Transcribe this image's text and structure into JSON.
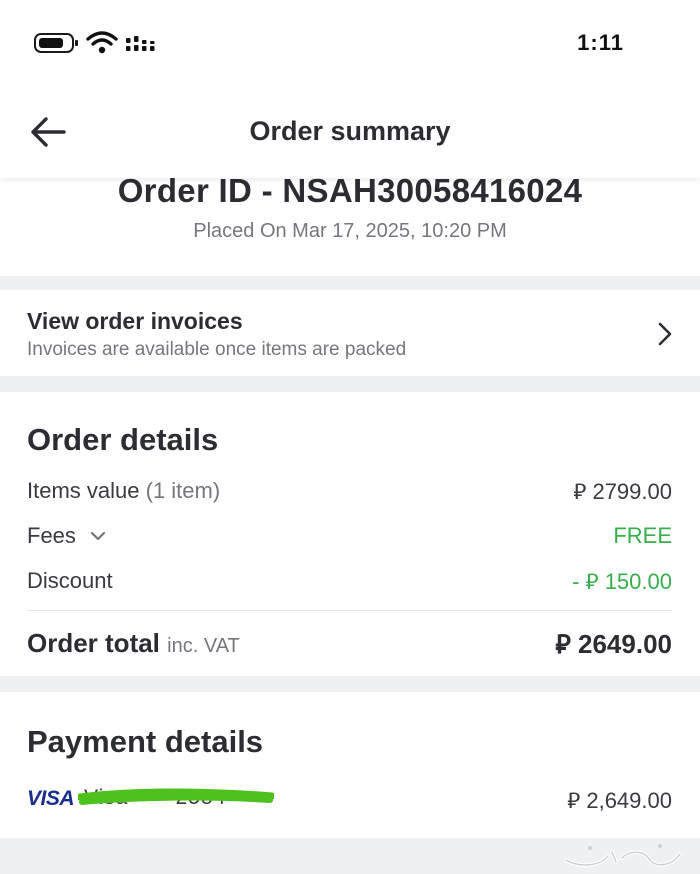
{
  "status_bar": {
    "time": "1:11",
    "icons": [
      "battery-icon",
      "wifi-icon",
      "signal-icon"
    ]
  },
  "header": {
    "back_icon": "back-arrow-icon",
    "title": "Order summary"
  },
  "order": {
    "id_label": "Order ID - NSAH30058416024",
    "placed_on": "Placed On Mar 17, 2025, 10:20 PM"
  },
  "invoices": {
    "title": "View order invoices",
    "subtitle": "Invoices are available once items are packed",
    "icon": "chevron-right-icon"
  },
  "order_details": {
    "title": "Order details",
    "items_label": "Items value",
    "items_count": "(1 item)",
    "items_value": "⃁ 2799.00",
    "fees_label": "Fees",
    "fees_icon": "chevron-down-icon",
    "fees_value": "FREE",
    "discount_label": "Discount",
    "discount_value": "- ⃁ 150.00",
    "total_label": "Order total",
    "total_suffix": "inc. VAT",
    "total_value": "⃁ 2649.00"
  },
  "payment_details": {
    "title": "Payment details",
    "card_brand": "VISA",
    "card_masked": "Visa •••• 2584",
    "amount": "⃁ 2,649.00"
  },
  "colors": {
    "accent_green": "#38ae4c",
    "text_primary": "#2c2d33",
    "text_muted": "#75777d",
    "visa_blue": "#1a2e8c",
    "scribble_green": "#4ec11d",
    "page_bg": "#eef0f2"
  }
}
